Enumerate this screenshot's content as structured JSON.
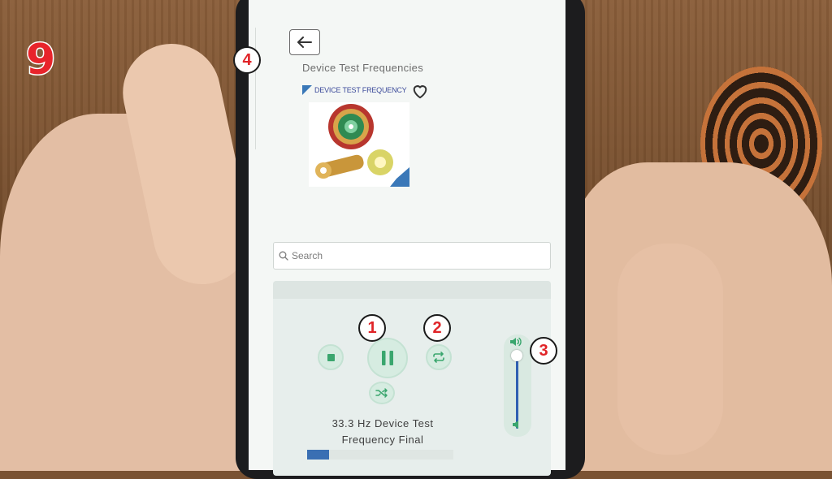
{
  "overlay": {
    "step_number": "9",
    "badges": [
      "1",
      "2",
      "3",
      "4"
    ],
    "badge_color": "#e02428"
  },
  "app": {
    "back_icon": "arrow-left-icon",
    "page_title": "Device Test Frequencies",
    "brand_logo_text": "DEVICE TEST FREQUENCY",
    "favorite_icon": "heart-outline-icon",
    "search": {
      "placeholder": "Search",
      "icon": "search-icon"
    },
    "player": {
      "stop_icon": "stop-icon",
      "pause_icon": "pause-icon",
      "repeat_icon": "repeat-icon",
      "shuffle_icon": "shuffle-icon",
      "volume_high_icon": "volume-high-icon",
      "volume_low_icon": "volume-low-icon",
      "volume_level": 0.85,
      "track_title_line1": "33.3 Hz Device Test",
      "track_title_line2": "Frequency Final",
      "progress_fraction": 0.15,
      "accent_color": "#3aa66e",
      "progress_color": "#3a6fb3"
    }
  }
}
